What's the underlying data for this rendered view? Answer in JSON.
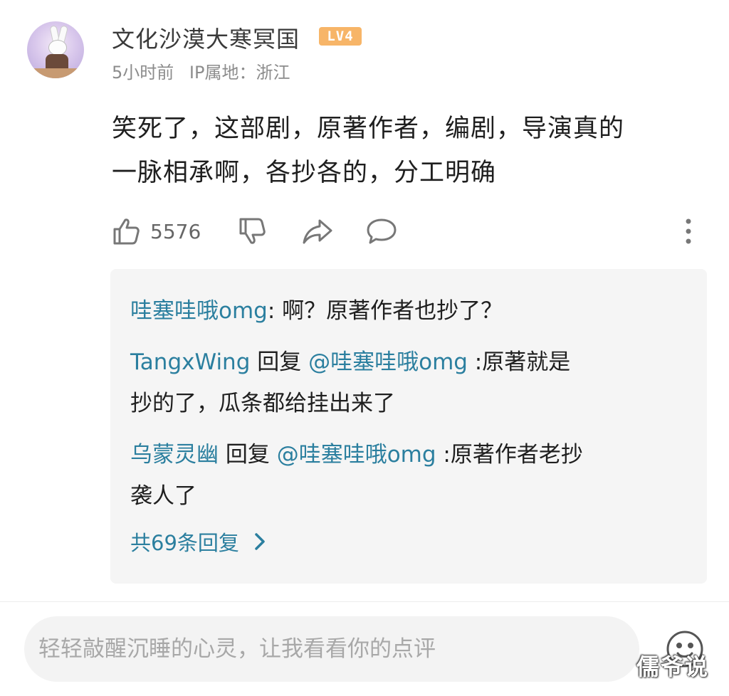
{
  "comment": {
    "username": "文化沙漠大寒冥国",
    "level": "LV4",
    "time": "5小时前",
    "ip_location": "IP属地：浙江",
    "text_line1": "笑死了，这部剧，原著作者，编剧，导演真的",
    "text_line2": "一脉相承啊，各抄各的，分工明确",
    "like_count": "5576",
    "colors": {
      "link": "#2b7f9f",
      "badge": "#f7b568"
    },
    "icons": [
      "thumbs-up-icon",
      "thumbs-down-icon",
      "share-icon",
      "comment-icon",
      "more-vertical-icon"
    ]
  },
  "replies": {
    "items": [
      {
        "name": "哇塞哇哦omg",
        "sep": ": ",
        "text_a": "啊？原著作者也抄了？"
      },
      {
        "name": "TangxWing",
        "reply_word": " 回复 ",
        "mention": "@哇塞哇哦omg",
        "text_a": " :原著就是",
        "text_b": "抄的了，瓜条都给挂出来了"
      },
      {
        "name": "乌蒙灵幽",
        "reply_word": " 回复 ",
        "mention": "@哇塞哇哦omg",
        "text_a": " :原著作者老抄",
        "text_b": "袭人了"
      }
    ],
    "more_label": "共69条回复"
  },
  "input": {
    "placeholder": "轻轻敲醒沉睡的心灵，让我看看你的点评"
  },
  "watermark": "儒爷说"
}
